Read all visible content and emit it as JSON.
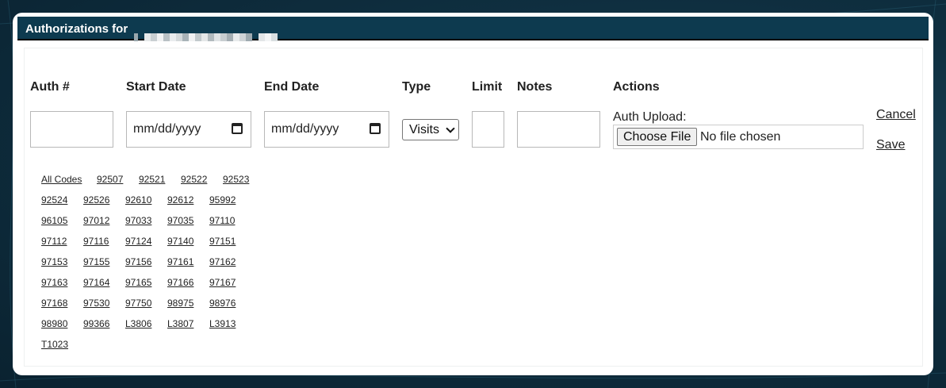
{
  "title": "Authorizations for",
  "columns": {
    "auth_no": "Auth #",
    "start_date": "Start Date",
    "end_date": "End Date",
    "type": "Type",
    "limit": "Limit",
    "notes": "Notes",
    "actions": "Actions"
  },
  "inputs": {
    "start_date_placeholder": "mm/dd/yyyy",
    "end_date_placeholder": "mm/dd/yyyy",
    "type_selected": "Visits"
  },
  "upload": {
    "label": "Auth Upload:",
    "button": "Choose File",
    "status": "No file chosen"
  },
  "actions": {
    "cancel": "Cancel",
    "save": "Save"
  },
  "codes": [
    [
      "All Codes",
      "92507",
      "92521",
      "92522",
      "92523"
    ],
    [
      "92524",
      "92526",
      "92610",
      "92612",
      "95992"
    ],
    [
      "96105",
      "97012",
      "97033",
      "97035",
      "97110"
    ],
    [
      "97112",
      "97116",
      "97124",
      "97140",
      "97151"
    ],
    [
      "97153",
      "97155",
      "97156",
      "97161",
      "97162"
    ],
    [
      "97163",
      "97164",
      "97165",
      "97166",
      "97167"
    ],
    [
      "97168",
      "97530",
      "97750",
      "98975",
      "98976"
    ],
    [
      "98980",
      "99366",
      "L3806",
      "L3807",
      "L3913"
    ],
    [
      "T1023"
    ]
  ],
  "colors": {
    "titlebar": "#0d3a4f",
    "card": "#ffffff",
    "background": "#0f2f40"
  }
}
